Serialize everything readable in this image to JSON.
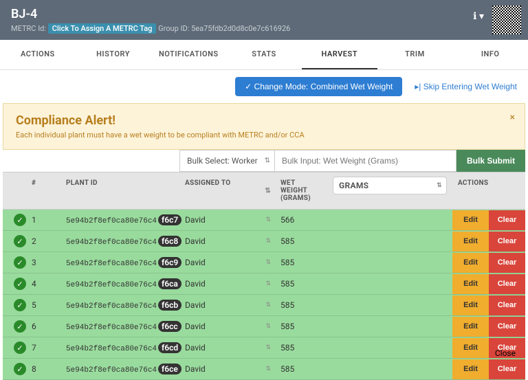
{
  "header": {
    "title": "BJ-4",
    "metrc_label": "METRC Id:",
    "metrc_tag_btn": "Click To Assign A METRC Tag",
    "group_label": "Group ID:",
    "group_id": "5ea75fdb2d0d8c0e7c616926"
  },
  "tabs": [
    "ACTIONS",
    "HISTORY",
    "NOTIFICATIONS",
    "STATS",
    "HARVEST",
    "TRIM",
    "INFO"
  ],
  "active_tab": "HARVEST",
  "actions": {
    "change_mode": "Change Mode: Combined Wet Weight",
    "skip": "Skip Entering Wet Weight"
  },
  "alert": {
    "title": "Compliance Alert!",
    "body": "Each individual plant must have a wet weight to be compliant with METRC and/or CCA"
  },
  "bulk": {
    "select_label": "Bulk Select: Worker",
    "input_placeholder": "Bulk Input: Wet Weight (Grams)",
    "submit": "Bulk Submit"
  },
  "columns": {
    "num": "#",
    "plant": "PLANT ID",
    "assigned": "ASSIGNED TO",
    "weight": "WET WEIGHT (GRAMS)",
    "unit_value": "Grams",
    "actions": "ACTIONS"
  },
  "row_actions": {
    "edit": "Edit",
    "clear": "Clear"
  },
  "rows": [
    {
      "n": 1,
      "plant_prefix": "5e94b2f8ef0ca80e76c4",
      "plant_suffix": "f6c7",
      "assigned": "David",
      "weight": "566"
    },
    {
      "n": 2,
      "plant_prefix": "5e94b2f8ef0ca80e76c4",
      "plant_suffix": "f6c8",
      "assigned": "David",
      "weight": "585"
    },
    {
      "n": 3,
      "plant_prefix": "5e94b2f8ef0ca80e76c4",
      "plant_suffix": "f6c9",
      "assigned": "David",
      "weight": "585"
    },
    {
      "n": 4,
      "plant_prefix": "5e94b2f8ef0ca80e76c4",
      "plant_suffix": "f6ca",
      "assigned": "David",
      "weight": "585"
    },
    {
      "n": 5,
      "plant_prefix": "5e94b2f8ef0ca80e76c4",
      "plant_suffix": "f6cb",
      "assigned": "David",
      "weight": "585"
    },
    {
      "n": 6,
      "plant_prefix": "5e94b2f8ef0ca80e76c4",
      "plant_suffix": "f6cc",
      "assigned": "David",
      "weight": "585"
    },
    {
      "n": 7,
      "plant_prefix": "5e94b2f8ef0ca80e76c4",
      "plant_suffix": "f6cd",
      "assigned": "David",
      "weight": "585"
    },
    {
      "n": 8,
      "plant_prefix": "5e94b2f8ef0ca80e76c4",
      "plant_suffix": "f6ce",
      "assigned": "David",
      "weight": "585"
    }
  ],
  "footer": {
    "close": "Close"
  }
}
